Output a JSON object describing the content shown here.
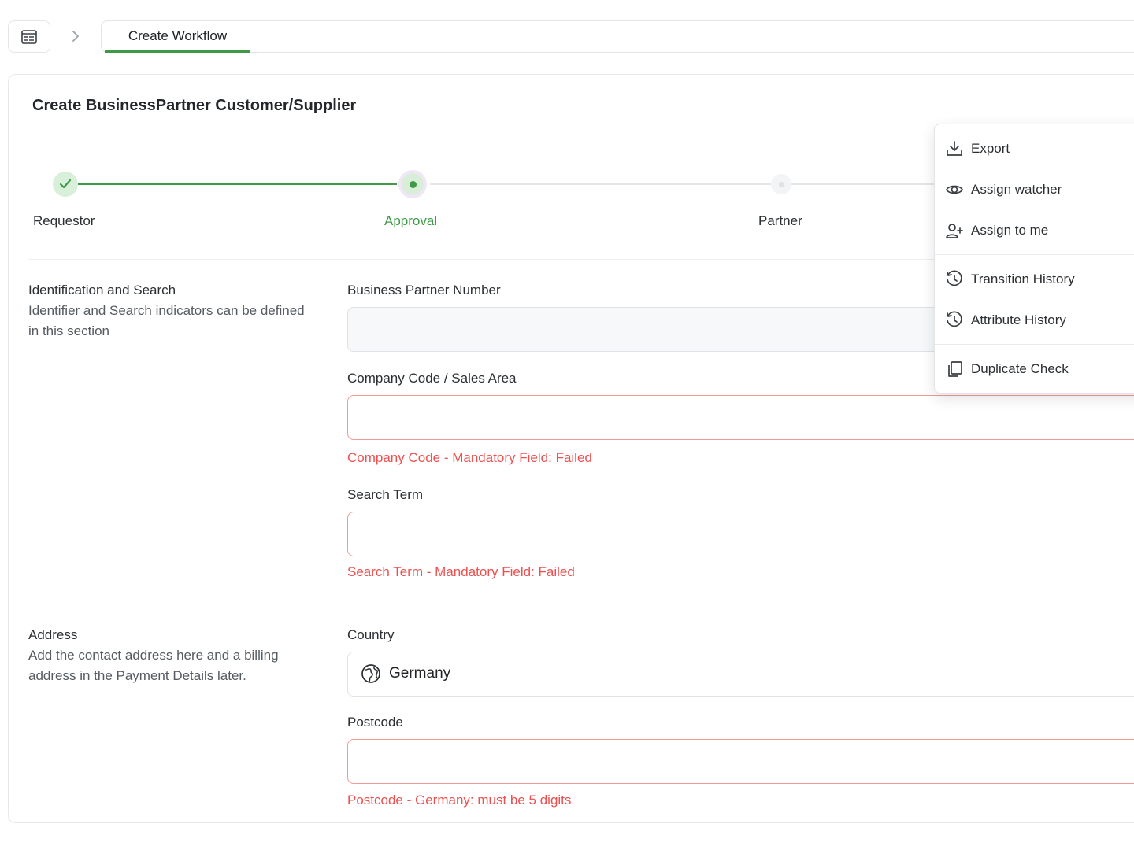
{
  "header": {
    "tab_label": "Create Workflow"
  },
  "card": {
    "title": "Create BusinessPartner Customer/Supplier"
  },
  "stepper": {
    "steps": [
      {
        "label": "Requestor",
        "state": "done"
      },
      {
        "label": "Approval",
        "state": "active"
      },
      {
        "label": "Partner",
        "state": "todo"
      }
    ]
  },
  "sections": {
    "identification": {
      "title": "Identification and Search",
      "description": "Identifier and Search indicators can be defined in this section",
      "fields": {
        "bp_number": {
          "label": "Business Partner Number",
          "value": ""
        },
        "company_code": {
          "label": "Company Code / Sales Area",
          "value": "",
          "error": "Company Code - Mandatory Field: Failed"
        },
        "search_term": {
          "label": "Search Term",
          "value": "",
          "error": "Search Term - Mandatory Field: Failed"
        }
      }
    },
    "address": {
      "title": "Address",
      "description": "Add the contact address here and a billing address in the Payment Details later.",
      "fields": {
        "country": {
          "label": "Country",
          "value": "Germany"
        },
        "postcode": {
          "label": "Postcode",
          "value": "",
          "error": "Postcode - Germany: must be 5 digits"
        }
      }
    }
  },
  "menu": {
    "items": [
      {
        "label": "Export",
        "icon": "download-icon"
      },
      {
        "label": "Assign watcher",
        "icon": "eye-icon"
      },
      {
        "label": "Assign to me",
        "icon": "user-plus-icon"
      },
      {
        "label": "Transition History",
        "icon": "history-icon"
      },
      {
        "label": "Attribute History",
        "icon": "history-icon"
      },
      {
        "label": "Duplicate Check",
        "icon": "copy-icon"
      }
    ]
  },
  "colors": {
    "accent": "#3e9a47",
    "error": "#ef4f4f",
    "active_halo": "#f1e6f8"
  }
}
